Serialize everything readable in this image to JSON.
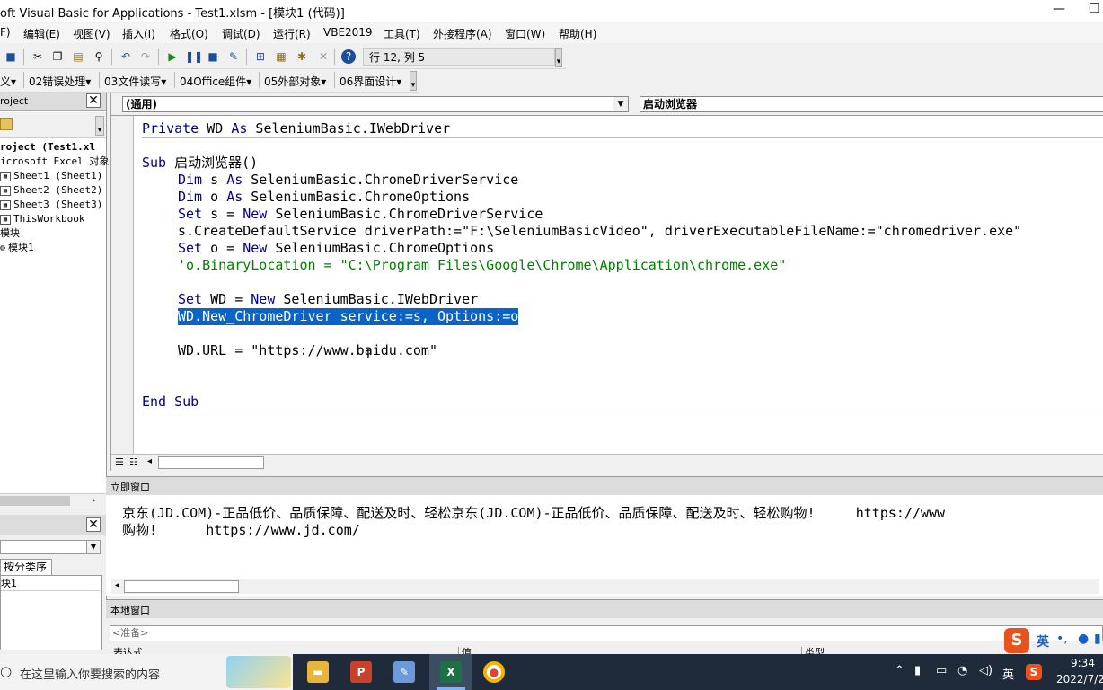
{
  "window": {
    "title": "oft Visual Basic for Applications - Test1.xlsm - [模块1 (代码)]",
    "minimize_glyph": "—",
    "restore_glyph": "❐"
  },
  "menu": [
    "F)",
    "编辑(E)",
    "视图(V)",
    "插入(I)",
    "格式(O)",
    "调试(D)",
    "运行(R)",
    "VBE2019",
    "工具(T)",
    "外接程序(A)",
    "窗口(W)",
    "帮助(H)"
  ],
  "toolbar": {
    "position": "行 12, 列 5",
    "custom_menus": [
      "义▾",
      "02错误处理▾",
      "03文件读写▾",
      "04Office组件▾",
      "05外部对象▾",
      "06界面设计▾"
    ]
  },
  "project_panel": {
    "title": "roject",
    "tree": [
      "roject (Test1.xl",
      "icrosoft Excel 对象",
      "Sheet1 (Sheet1)",
      "Sheet2 (Sheet2)",
      "Sheet3 (Sheet3)",
      "ThisWorkbook",
      "模块",
      "模块1"
    ]
  },
  "properties_panel": {
    "tab": "按分类序",
    "item": "块1"
  },
  "code_window": {
    "object_combo": "(通用)",
    "proc_combo": "启动浏览器",
    "lines": [
      {
        "indent": 0,
        "text": "Private WD As SeleniumBasic.IWebDriver"
      },
      {
        "indent": 0,
        "text": ""
      },
      {
        "indent": 0,
        "text": "Sub 启动浏览器()"
      },
      {
        "indent": 1,
        "text": "Dim s As SeleniumBasic.ChromeDriverService"
      },
      {
        "indent": 1,
        "text": "Dim o As SeleniumBasic.ChromeOptions"
      },
      {
        "indent": 1,
        "text": "Set s = New SeleniumBasic.ChromeDriverService"
      },
      {
        "indent": 1,
        "text": "s.CreateDefaultService driverPath:=\"F:\\SeleniumBasicVideo\", driverExecutableFileName:=\"chromedriver.exe\""
      },
      {
        "indent": 1,
        "text": "Set o = New SeleniumBasic.ChromeOptions"
      },
      {
        "indent": 1,
        "text": "'o.BinaryLocation = \"C:\\Program Files\\Google\\Chrome\\Application\\chrome.exe\""
      },
      {
        "indent": 0,
        "text": ""
      },
      {
        "indent": 1,
        "text": "Set WD = New SeleniumBasic.IWebDriver"
      },
      {
        "indent": 1,
        "text": "WD.New_ChromeDriver service:=s, Options:=o"
      },
      {
        "indent": 0,
        "text": ""
      },
      {
        "indent": 1,
        "text": "WD.URL = \"https://www.baidu.com\""
      },
      {
        "indent": 0,
        "text": ""
      },
      {
        "indent": 0,
        "text": ""
      },
      {
        "indent": 0,
        "text": "End Sub"
      }
    ]
  },
  "immediate": {
    "title": "立即窗口",
    "line1": "京东(JD.COM)-正品低价、品质保障、配送及时、轻松京东(JD.COM)-正品低价、品质保障、配送及时、轻松购物!     https://www",
    "line2": "购物!      https://www.jd.com/"
  },
  "locals": {
    "title": "本地窗口",
    "status": "<准备>",
    "col1": "表达式",
    "col2": "值",
    "col3": "类型"
  },
  "ime": {
    "logo": "S",
    "lang": "英"
  },
  "taskbar": {
    "search_placeholder": "在这里输入你要搜索的内容",
    "tray_lang": "英",
    "time": "9:34",
    "date": "2022/7/2"
  }
}
